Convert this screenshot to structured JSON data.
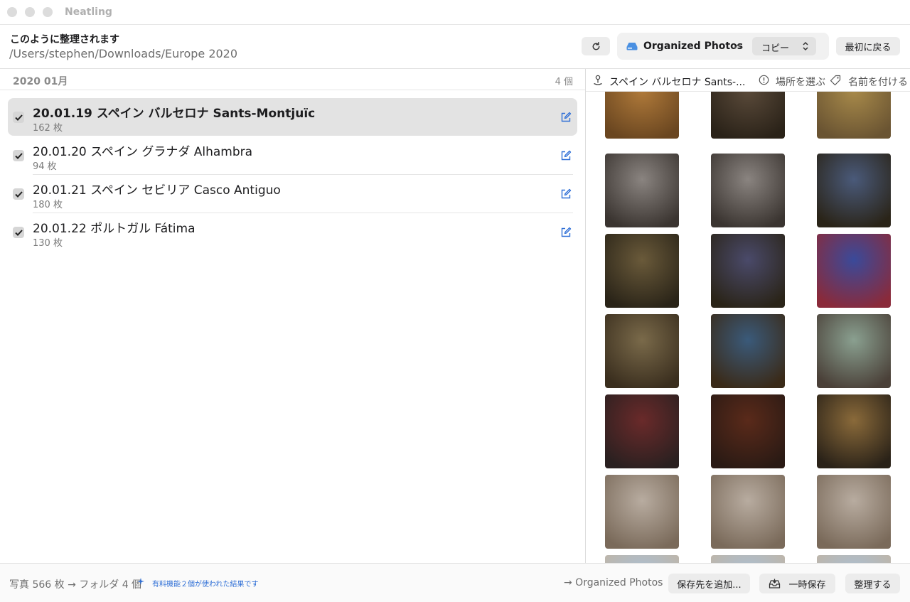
{
  "window": {
    "title": "Neatling"
  },
  "header": {
    "title": "このように整理されます",
    "path": "/Users/stephen/Downloads/Europe 2020",
    "destination_label": "Organized Photos",
    "mode_label": "コピー",
    "back_label": "最初に戻る"
  },
  "list": {
    "month_label": "2020 01月",
    "month_count": "4 個",
    "items": [
      {
        "title": "20.01.19 スペイン バルセロナ Sants-Montjuïc",
        "count": "162 枚",
        "checked": true,
        "selected": true
      },
      {
        "title": "20.01.20 スペイン グラナダ Alhambra",
        "count": "94 枚",
        "checked": true,
        "selected": false
      },
      {
        "title": "20.01.21 スペイン セビリア Casco Antiguo",
        "count": "180 枚",
        "checked": true,
        "selected": false
      },
      {
        "title": "20.01.22 ポルトガル Fátima",
        "count": "130 枚",
        "checked": true,
        "selected": false
      }
    ]
  },
  "preview": {
    "location_label": "スペイン バルセロナ Sants-...",
    "choose_place_label": "場所を選ぶ",
    "name_label": "名前を付ける",
    "thumbnails": [
      {
        "c1": "#b07a3a",
        "c2": "#6a4620"
      },
      {
        "c1": "#5a4a3a",
        "c2": "#2a2218"
      },
      {
        "c1": "#a88a4a",
        "c2": "#6a5432"
      },
      {
        "c1": "#8a8480",
        "c2": "#3a3430"
      },
      {
        "c1": "#8a8480",
        "c2": "#3a3430"
      },
      {
        "c1": "#4a5a7a",
        "c2": "#2a2418"
      },
      {
        "c1": "#6a5a3a",
        "c2": "#2a2418"
      },
      {
        "c1": "#4a4a6a",
        "c2": "#2a2418"
      },
      {
        "c1": "#3a4a9a",
        "c2": "#8a2a3a"
      },
      {
        "c1": "#7a6a4a",
        "c2": "#3a2e1e"
      },
      {
        "c1": "#3a5a7a",
        "c2": "#3a2a18"
      },
      {
        "c1": "#8aa090",
        "c2": "#4a4038"
      },
      {
        "c1": "#6a2a2a",
        "c2": "#2a2020"
      },
      {
        "c1": "#5a2a1a",
        "c2": "#2a1a14"
      },
      {
        "c1": "#8a6a3a",
        "c2": "#2a2218"
      },
      {
        "c1": "#b8aca0",
        "c2": "#7a6a5a"
      },
      {
        "c1": "#b8aca0",
        "c2": "#7a6a5a"
      },
      {
        "c1": "#b8aca0",
        "c2": "#7a6a5a"
      },
      {
        "c1": "#a8c0d8",
        "c2": "#c0b4a4"
      },
      {
        "c1": "#a8c0d8",
        "c2": "#c0b4a4"
      },
      {
        "c1": "#a8c0d8",
        "c2": "#c0b4a4"
      }
    ]
  },
  "footer": {
    "summary": "写真 566 枚 → フォルダ 4 個",
    "paid_note": "有料機能２個が使われた結果です",
    "destination": "→ Organized Photos",
    "add_dest_label": "保存先を追加...",
    "stash_label": "一時保存",
    "organize_label": "整理する"
  },
  "colors": {
    "accent": "#2f6fd6"
  }
}
